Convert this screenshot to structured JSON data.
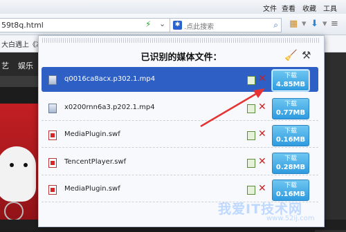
{
  "menubar": {
    "items": [
      "文件",
      "查看",
      "收藏",
      "工具"
    ],
    "window_controls": [
      "—",
      "□",
      "✕"
    ]
  },
  "address": {
    "url": "59t8q.html",
    "search_placeholder": ".点此搜索"
  },
  "bookmarks": {
    "text": "大白遇上《冰雪"
  },
  "page": {
    "nav": [
      "艺",
      "娱乐"
    ]
  },
  "popup": {
    "title": "已识别的媒体文件：",
    "files": [
      {
        "name": "q0016ca8acx.p302.1.mp4",
        "type": "video",
        "size": "4.85MB",
        "selected": true
      },
      {
        "name": "x0200rnn6a3.p202.1.mp4",
        "type": "video",
        "size": "0.77MB",
        "selected": false
      },
      {
        "name": "MediaPlugin.swf",
        "type": "flash",
        "size": "0.16MB",
        "selected": false
      },
      {
        "name": "TencentPlayer.swf",
        "type": "flash",
        "size": "0.28MB",
        "selected": false
      },
      {
        "name": "MediaPlugin.swf",
        "type": "flash",
        "size": "0.16MB",
        "selected": false
      }
    ],
    "download_label": "下载"
  },
  "watermark": {
    "main": "我爱IT技术网",
    "sub": "www.52ij.com"
  },
  "colors": {
    "accent": "#2e5fc4",
    "button": "#3aa5e6",
    "delete": "#cc1f1f",
    "arrow": "#e53333"
  }
}
